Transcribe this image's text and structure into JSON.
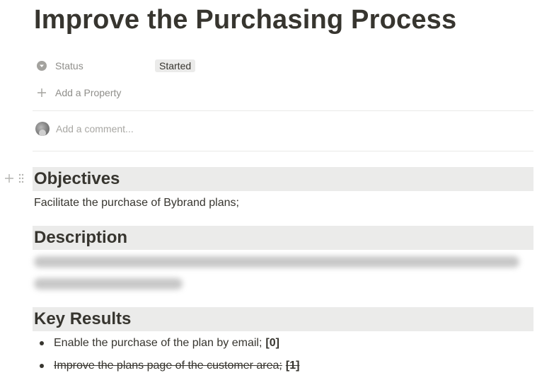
{
  "page": {
    "title": "Improve the Purchasing Process"
  },
  "properties": {
    "status": {
      "label": "Status",
      "value": "Started"
    },
    "add_property": "Add a Property"
  },
  "comment": {
    "placeholder": "Add a comment..."
  },
  "sections": {
    "objectives": {
      "heading": "Objectives",
      "text": "Facilitate the purchase of Bybrand plans;"
    },
    "description": {
      "heading": "Description"
    },
    "key_results": {
      "heading": "Key Results",
      "items": [
        {
          "text": "Enable the purchase of the plan by email;",
          "tag": "[0]",
          "done": false
        },
        {
          "text": "Improve the plans page of the customer area;",
          "tag": "[1]",
          "done": true
        }
      ]
    }
  },
  "colors": {
    "text": "#37352f",
    "muted": "#8f8e8a",
    "heading_bg": "#ebebea",
    "tag_bg": "#ebebea",
    "divider": "#e9e9e7"
  },
  "icons": {
    "status": "status-dropdown-icon",
    "add_property": "plus-icon",
    "block_add": "plus-icon",
    "block_drag": "drag-handle-icon"
  }
}
